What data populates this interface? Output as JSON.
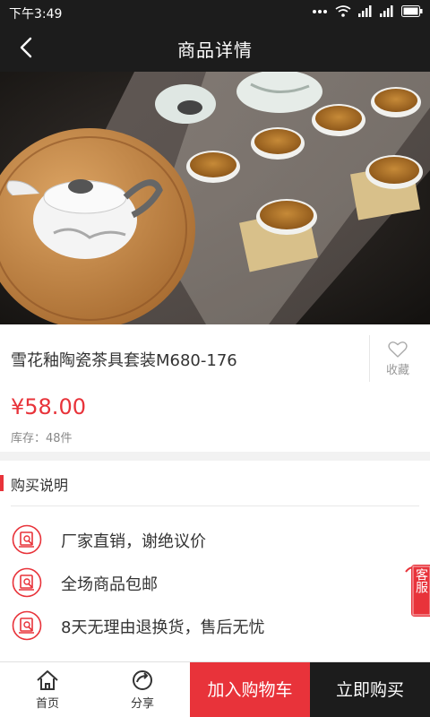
{
  "status_bar": {
    "time": "下午3:49",
    "icons": [
      "dots-icon",
      "wifi-icon",
      "signal-icon",
      "signal-icon",
      "battery-icon"
    ]
  },
  "header": {
    "title": "商品详情",
    "back_icon": "chevron-left-icon"
  },
  "banner": {
    "image": "teapot-set-photo",
    "slide_count": 1,
    "active_slide": 1
  },
  "product": {
    "title": "雪花釉陶瓷茶具套装M680-176",
    "price": "¥58.00",
    "stock": "库存：48件",
    "favorite_label": "收藏",
    "favorite_icon": "heart-outline-icon"
  },
  "purchase_info": {
    "title": "购买说明",
    "items": [
      {
        "icon": "guarantee-icon",
        "text": "厂家直销，谢绝议价"
      },
      {
        "icon": "guarantee-icon",
        "text": "全场商品包邮"
      },
      {
        "icon": "guarantee-icon",
        "text": "8天无理由退换货，售后无忧"
      }
    ]
  },
  "service_label": "客服",
  "bottom_bar": {
    "home_label": "首页",
    "share_label": "分享",
    "cart_label": "加入购物车",
    "buy_label": "立即购买"
  },
  "colors": {
    "accent": "#e8333a",
    "dark": "#1c1c1c"
  }
}
